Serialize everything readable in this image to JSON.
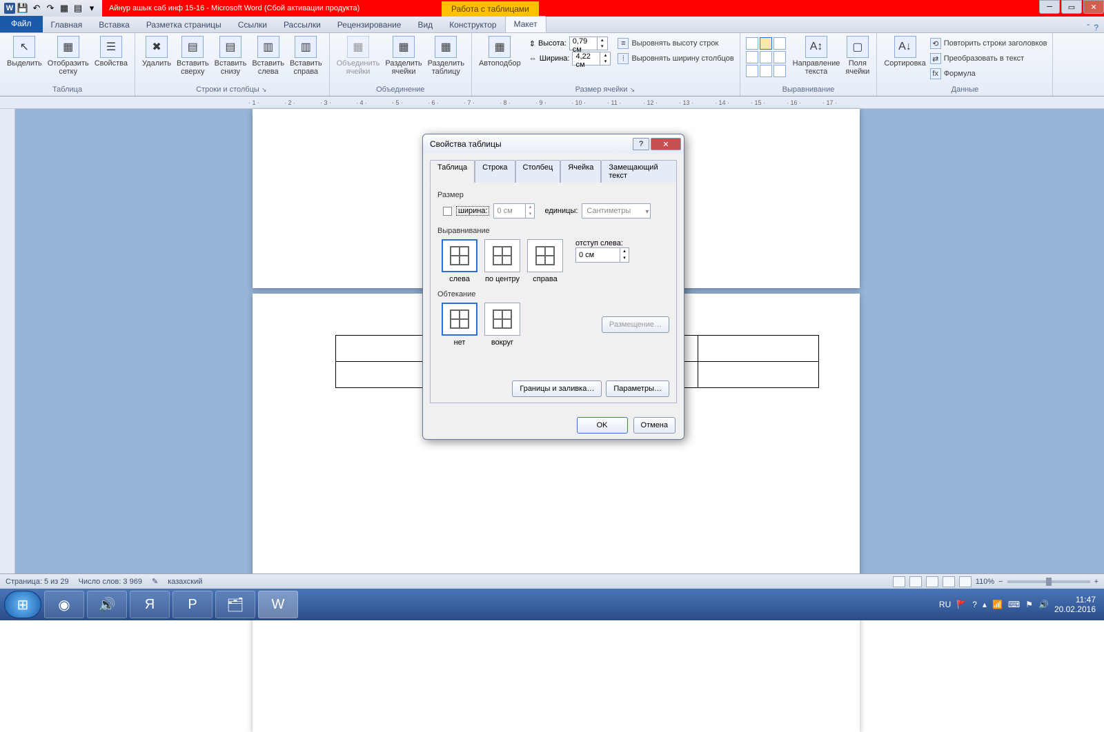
{
  "titlebar": {
    "doc_title": "Айнур ашык саб инф 15-16  -  Microsoft Word (Сбой активации продукта)",
    "context_tab": "Работа с таблицами"
  },
  "ribbon_tabs": {
    "file": "Файл",
    "items": [
      "Главная",
      "Вставка",
      "Разметка страницы",
      "Ссылки",
      "Рассылки",
      "Рецензирование",
      "Вид",
      "Конструктор",
      "Макет"
    ],
    "active": "Макет"
  },
  "ribbon": {
    "g1_label": "Таблица",
    "g1_select": "Выделить",
    "g1_grid": "Отобразить\nсетку",
    "g1_props": "Свойства",
    "g2_label": "Строки и столбцы",
    "g2_del": "Удалить",
    "g2_top": "Вставить\nсверху",
    "g2_bot": "Вставить\nснизу",
    "g2_left": "Вставить\nслева",
    "g2_right": "Вставить\nсправа",
    "g3_label": "Объединение",
    "g3_merge": "Объединить\nячейки",
    "g3_splitc": "Разделить\nячейки",
    "g3_splitt": "Разделить\nтаблицу",
    "g4_label": "Размер ячейки",
    "g4_auto": "Автоподбор",
    "g4_h": "Высота:",
    "g4_hv": "0,79 см",
    "g4_w": "Ширина:",
    "g4_wv": "4,22 см",
    "g4_rows": "Выровнять высоту строк",
    "g4_cols": "Выровнять ширину столбцов",
    "g5_label": "Выравнивание",
    "g5_dir": "Направление\nтекста",
    "g5_marg": "Поля\nячейки",
    "g6_label": "Данные",
    "g6_sort": "Сортировка",
    "g6_rep": "Повторить строки заголовков",
    "g6_conv": "Преобразовать в текст",
    "g6_fx": "Формула"
  },
  "dialog": {
    "title": "Свойства таблицы",
    "tabs": [
      "Таблица",
      "Строка",
      "Столбец",
      "Ячейка",
      "Замещающий текст"
    ],
    "active_tab": "Таблица",
    "size_label": "Размер",
    "width_label": "ширина:",
    "width_val": "0 см",
    "units_label": "единицы:",
    "units_val": "Сантиметры",
    "align_label": "Выравнивание",
    "align_left": "слева",
    "align_center": "по центру",
    "align_right": "справа",
    "indent_label": "отступ слева:",
    "indent_val": "0 см",
    "wrap_label": "Обтекание",
    "wrap_none": "нет",
    "wrap_around": "вокруг",
    "place_btn": "Размещение…",
    "borders_btn": "Границы и заливка…",
    "params_btn": "Параметры…",
    "ok": "OK",
    "cancel": "Отмена"
  },
  "status": {
    "page": "Страница: 5 из 29",
    "words": "Число слов: 3 969",
    "lang": "казахский",
    "zoom": "110%"
  },
  "tray": {
    "lang": "RU",
    "time": "11:47",
    "date": "20.02.2016"
  }
}
